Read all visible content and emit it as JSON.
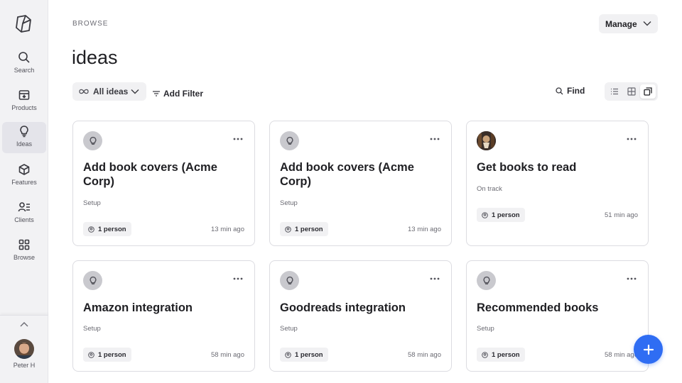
{
  "sidebar": {
    "items": [
      {
        "label": "Search",
        "icon": "search-icon"
      },
      {
        "label": "Products",
        "icon": "products-icon"
      },
      {
        "label": "Ideas",
        "icon": "lightbulb-icon",
        "active": true
      },
      {
        "label": "Features",
        "icon": "cube-icon"
      },
      {
        "label": "Clients",
        "icon": "clients-icon"
      },
      {
        "label": "Browse",
        "icon": "grid-icon"
      }
    ],
    "user_name": "Peter H"
  },
  "header": {
    "breadcrumb": "BROWSE",
    "manage_label": "Manage",
    "title": "ideas"
  },
  "filters": {
    "view_label": "All ideas",
    "add_filter_label": "Add Filter",
    "find_label": "Find",
    "view_modes": [
      "list",
      "grid",
      "cards"
    ],
    "active_view": "cards"
  },
  "cards": [
    {
      "title": "Add book covers (Acme Corp)",
      "status": "Setup",
      "people": "1 person",
      "time": "13 min ago",
      "icon": "lightbulb-icon"
    },
    {
      "title": "Add book covers (Acme Corp)",
      "status": "Setup",
      "people": "1 person",
      "time": "13 min ago",
      "icon": "lightbulb-icon"
    },
    {
      "title": "Get books to read",
      "status": "On track",
      "people": "1 person",
      "time": "51 min ago",
      "icon": "photo-avatar"
    },
    {
      "title": "Amazon integration",
      "status": "Setup",
      "people": "1 person",
      "time": "58 min ago",
      "icon": "lightbulb-icon"
    },
    {
      "title": "Goodreads integration",
      "status": "Setup",
      "people": "1 person",
      "time": "58 min ago",
      "icon": "lightbulb-icon"
    },
    {
      "title": "Recommended books",
      "status": "Setup",
      "people": "1 person",
      "time": "58 min ago",
      "icon": "lightbulb-icon"
    }
  ],
  "colors": {
    "accent": "#2f6df3",
    "sidebar_bg": "#f2f2f4",
    "card_border": "#dcdce1"
  }
}
